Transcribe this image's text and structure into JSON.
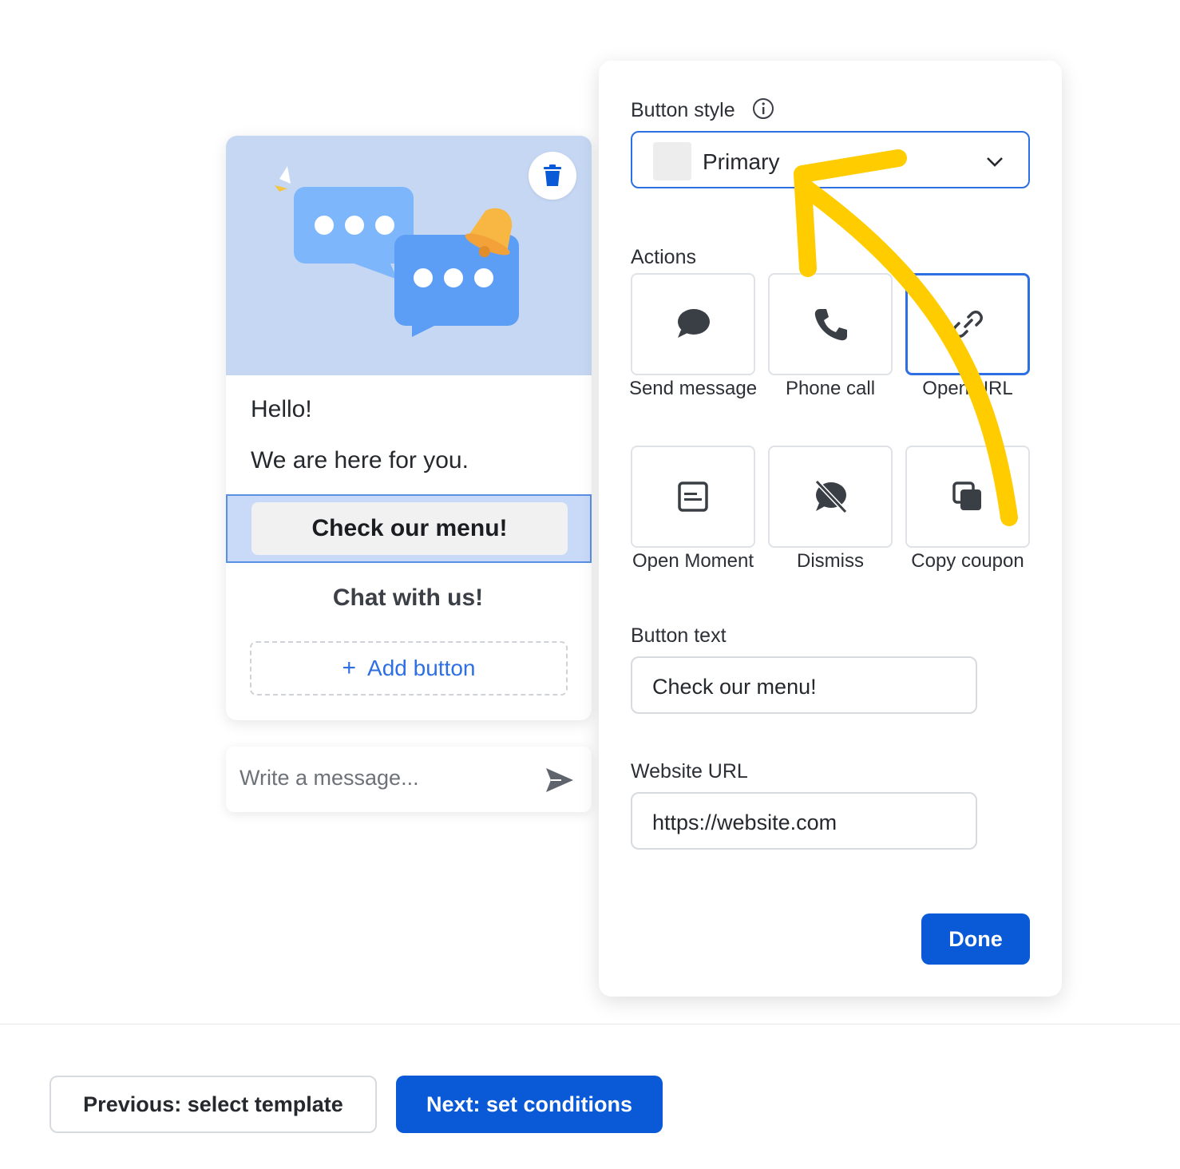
{
  "preview": {
    "greeting": "Hello!",
    "subtitle": "We are here for you.",
    "primary_button": "Check our menu!",
    "secondary_button": "Chat with us!",
    "add_button": "Add button",
    "add_button_symbol": "+",
    "message_placeholder": "Write a message..."
  },
  "panel": {
    "button_style_label": "Button style",
    "button_style_value": "Primary",
    "actions_label": "Actions",
    "actions": [
      {
        "label": "Send message",
        "icon": "chat-bubble-icon",
        "selected": false
      },
      {
        "label": "Phone call",
        "icon": "phone-icon",
        "selected": false
      },
      {
        "label": "Open URL",
        "icon": "link-icon",
        "selected": true
      },
      {
        "label": "Open Moment",
        "icon": "moment-icon",
        "selected": false
      },
      {
        "label": "Dismiss",
        "icon": "dismiss-icon",
        "selected": false
      },
      {
        "label": "Copy coupon",
        "icon": "copy-icon",
        "selected": false
      }
    ],
    "button_text_label": "Button text",
    "button_text_value": "Check our menu!",
    "website_url_label": "Website URL",
    "website_url_value": "https://website.com",
    "done_label": "Done"
  },
  "footer": {
    "previous_label": "Previous: select template",
    "next_label": "Next: set conditions"
  },
  "colors": {
    "accent": "#0a5ad8",
    "selection": "#2f6fe4",
    "media_bg": "#c6d7f3",
    "annotation": "#ffcc00"
  }
}
